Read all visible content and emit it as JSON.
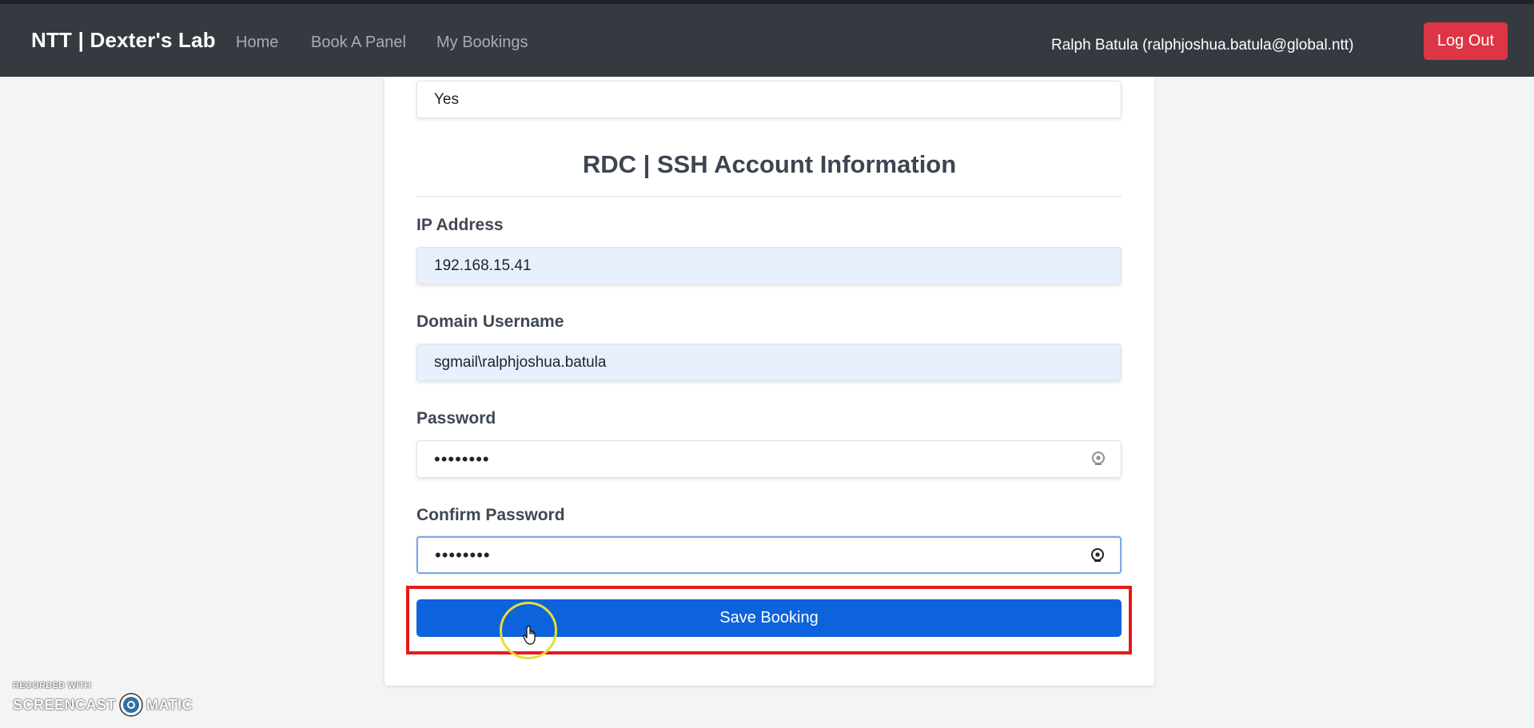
{
  "navbar": {
    "brand": "NTT | Dexter's Lab",
    "links": [
      "Home",
      "Book A Panel",
      "My Bookings"
    ],
    "user": "Ralph Batula (ralphjoshua.batula@global.ntt)",
    "logout_label": "Log Out"
  },
  "form": {
    "previous_field_value": "Yes",
    "section_title": "RDC | SSH Account Information",
    "ip_address": {
      "label": "IP Address",
      "value": "192.168.15.41"
    },
    "domain_username": {
      "label": "Domain Username",
      "value": "sgmail\\ralphjoshua.batula"
    },
    "password": {
      "label": "Password",
      "value": "••••••••"
    },
    "confirm_password": {
      "label": "Confirm Password",
      "value": "••••••••"
    },
    "save_label": "Save Booking"
  },
  "watermark": {
    "line1": "RECORDED WITH",
    "left": "SCREENCAST",
    "right": "MATIC"
  },
  "colors": {
    "navbar": "#343a40",
    "logout": "#dc3545",
    "primary": "#0d63db",
    "highlight": "#e41b1b",
    "autofill": "#e8f0fe"
  },
  "icons": [
    "eye-icon",
    "hand-pointer-icon",
    "screencast-logo-icon"
  ]
}
